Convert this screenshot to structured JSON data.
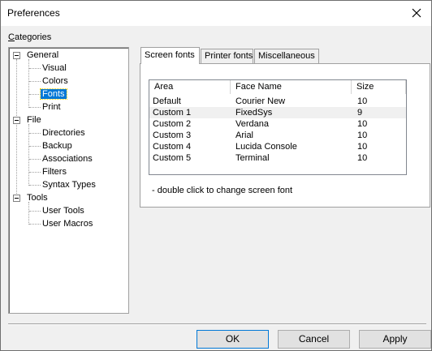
{
  "window": {
    "title": "Preferences"
  },
  "categories": {
    "label": "Categories",
    "tree": [
      {
        "label": "General",
        "children": [
          "Visual",
          "Colors",
          "Fonts",
          "Print"
        ]
      },
      {
        "label": "File",
        "children": [
          "Directories",
          "Backup",
          "Associations",
          "Filters",
          "Syntax Types"
        ]
      },
      {
        "label": "Tools",
        "children": [
          "User Tools",
          "User Macros"
        ]
      }
    ],
    "selected": "Fonts"
  },
  "tabs": {
    "screen": "Screen fonts",
    "printer": "Printer fonts",
    "misc": "Miscellaneous",
    "active": "Screen fonts"
  },
  "font_table": {
    "columns": [
      "Area",
      "Face Name",
      "Size"
    ],
    "rows": [
      [
        "Default",
        "Courier New",
        "10"
      ],
      [
        "Custom 1",
        "FixedSys",
        "9"
      ],
      [
        "Custom 2",
        "Verdana",
        "10"
      ],
      [
        "Custom 3",
        "Arial",
        "10"
      ],
      [
        "Custom 4",
        "Lucida Console",
        "10"
      ],
      [
        "Custom 5",
        "Terminal",
        "10"
      ]
    ]
  },
  "hint": "- double click to change screen font",
  "buttons": {
    "ok": "OK",
    "cancel": "Cancel",
    "apply": "Apply"
  }
}
